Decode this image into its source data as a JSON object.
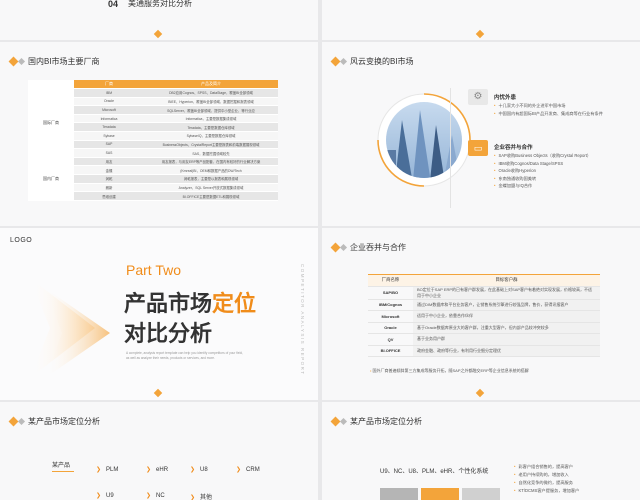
{
  "top_left": {
    "number": "04",
    "title": "美通服务对比分析"
  },
  "slide_domestic": {
    "title": "国内BI市场主要厂商",
    "headers": [
      "厂商",
      "产品及简介"
    ],
    "group_intl": "国际厂商",
    "group_domestic": "国内厂商",
    "rows_intl": [
      [
        "IBM",
        "DB2应用Cognos、SPSS、DataStage，覆盖BI全部领域"
      ],
      [
        "Oracle",
        "BIEE、Hyperion，覆盖BI全部领域，数据挖掘和报表领域"
      ],
      [
        "Microsoft",
        "SQLServer，覆盖BI全部领域，提供中小型企业，等行业应"
      ],
      [
        "Informatica",
        "Informatica，主要是数据集成领域"
      ],
      [
        "Teradata",
        "Teradata，主要是数据仓库领域"
      ],
      [
        "Sybase",
        "SybaseIQ，主要是数据仓库领域"
      ],
      [
        "SAP",
        "BusinessObjects、CrystalReport主要是报表和前端数据展现领域"
      ],
      [
        "SAS",
        "SAS，数据挖掘领域较先"
      ]
    ],
    "rows_domestic": [
      [
        "用友",
        "用友报表，与用友ERP等产品配套，在国内有较好的行业解决方案"
      ],
      [
        "金蝶",
        "(Kmreal)BI，OEM和数据产品的DW/Tech"
      ],
      [
        "润乾",
        "润乾报表，主要是以报表和展现领域"
      ],
      [
        "朗新",
        "Analyzer，SQL Server开放式数据集成领域"
      ],
      [
        "思维创建",
        "BI.OFFICE主要是数据ETL和展现领域"
      ]
    ]
  },
  "slide_market": {
    "title": "风云变换的BI市场",
    "sec1": {
      "title": "内忧外患",
      "bullets": [
        "十几家大小不同的外企进军中国市场",
        "中国国内有超国际BI产品开发商、集成商等在行业有条件"
      ]
    },
    "sec2": {
      "title": "企业吞并与合作",
      "bullets": [
        "SAP收购Business Objects（收购Crystal Report）",
        "IBM收购Cognos/Data Stage/SPSS",
        "Oracle收购Hyperion",
        "东南独通收购国美转",
        "金蝶加盟与IQ合作"
      ]
    }
  },
  "slide_part": {
    "logo": "LOGO",
    "part_label": "Part",
    "part_number": "Two",
    "title_prefix": "产品市场",
    "title_highlight": "定位",
    "title_line2": "对比分析",
    "desc": "A complete, analysis report template can help you identify competitors of your field, as well as analyze their needs, products or services, and more.",
    "vertical": "COMPETITOR ANALYSIS REPORT"
  },
  "slide_merge": {
    "title": "企业吞并与合作",
    "headers": [
      "厂商名称",
      "目标客户群"
    ],
    "rows": [
      [
        "SAP/BO",
        "BO定位于SAP ERP的已有客户群发展，在此基础上对SAP客户有着绝对实现发展，价格较高，不适用于中小企业"
      ],
      [
        "IBM/Cognos",
        "通过DIM数据库和平台业务客户，让销售系统引擎进行较强品牌，售价，获得讯报客户"
      ],
      [
        "Microsoft",
        "适用于中小企业，依靠合作伙伴"
      ],
      [
        "Oracle",
        "基于Oracle数据库原业大的客户群，注重大型客户，但内部产品较冲突较多"
      ],
      [
        "QV",
        "基于业务用户群"
      ],
      [
        "BI.OFFICE",
        "政府金融、政府等行业，有利用行业细分定理优"
      ]
    ],
    "note": "国外厂商普遍倾斜第三方集成等服务开拓，随SAP之外都融交ERP等企业信息系统的搭解"
  },
  "slide_pos1": {
    "title": "某产品市场定位分析",
    "root": "某产品",
    "items": [
      "PLM",
      "eHR",
      "U8",
      "CRM",
      "U9",
      "NC",
      "其他"
    ]
  },
  "slide_pos2": {
    "title": "某产品市场定位分析",
    "headline": "U9、NC、U8、PLM、eHR、个性化系统",
    "bullets": [
      "彩客户组合销售的，提高客户",
      "老用户持续购的，增加收入",
      "自然化竞争的微约，提高服务",
      "KT/DCMS客户提服务，增加客户"
    ]
  },
  "colors": {
    "accent": "#f3a43a",
    "accent_dark": "#f08c1a",
    "slide_bg": "#f8f8f9"
  }
}
